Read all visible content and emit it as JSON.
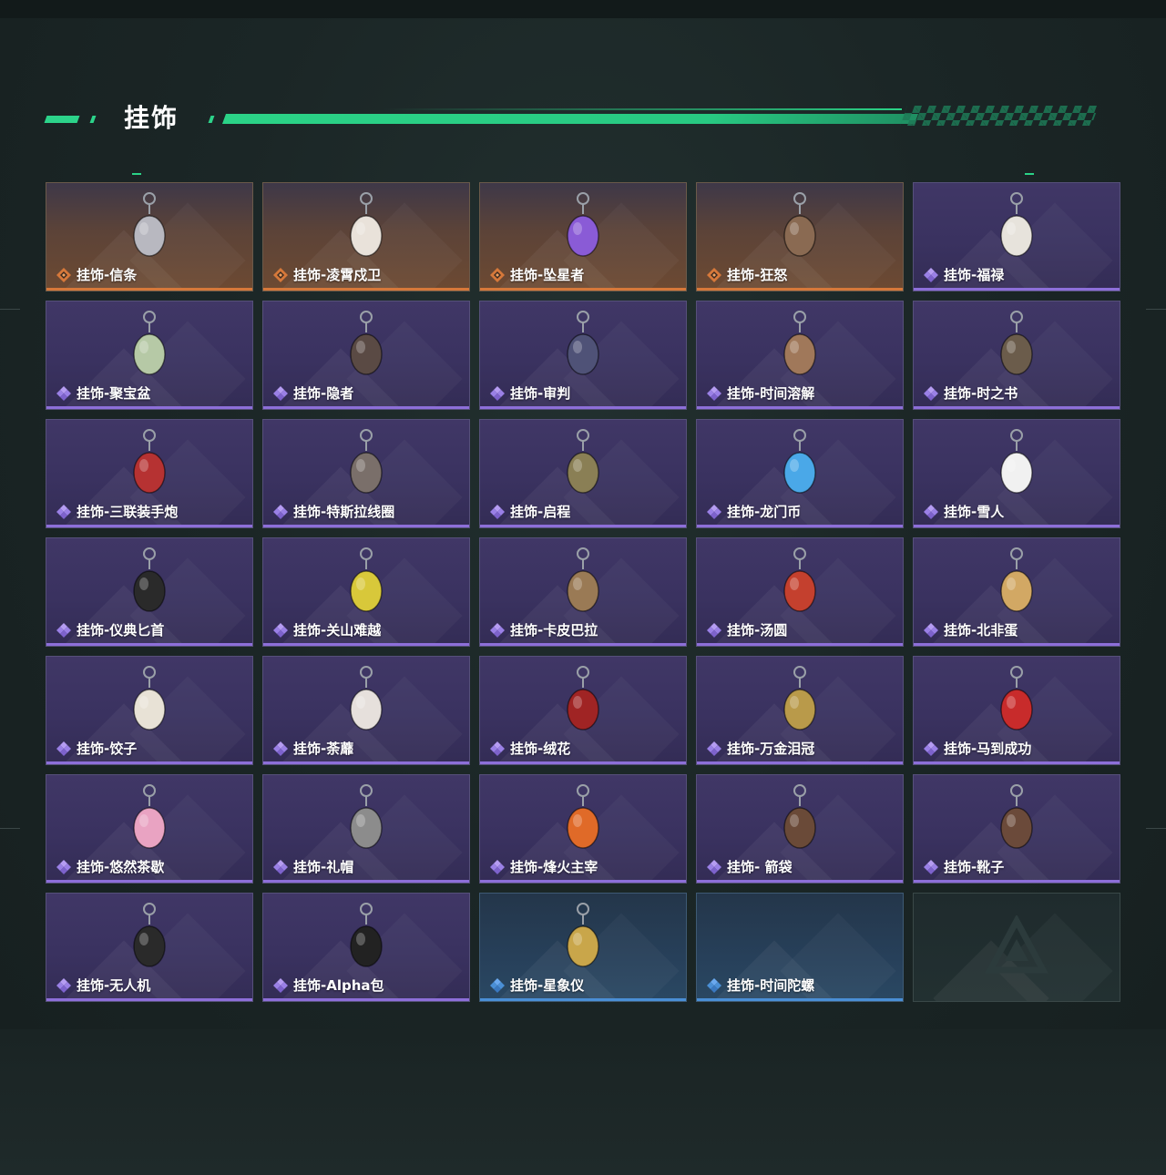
{
  "page": {
    "title": "挂饰"
  },
  "colors": {
    "accent": "#2bd387",
    "purple_rarity": "#8d6fd9",
    "orange_rarity": "#d6783a",
    "blue_rarity": "#4a8fd6"
  },
  "items": [
    {
      "label": "挂饰-信条",
      "rarity": "orange",
      "icon": "charm-silver-pendant",
      "color": "#b8b8c0"
    },
    {
      "label": "挂饰-凌霄戍卫",
      "rarity": "orange",
      "icon": "charm-rocket-figure",
      "color": "#e9e2da"
    },
    {
      "label": "挂饰-坠星者",
      "rarity": "orange",
      "icon": "charm-purple-crystal",
      "color": "#8a5bd6"
    },
    {
      "label": "挂饰-狂怒",
      "rarity": "orange",
      "icon": "charm-bronze-key",
      "color": "#8a6a52"
    },
    {
      "label": "挂饰-福禄",
      "rarity": "purple",
      "icon": "charm-gourd",
      "color": "#e7e3dc"
    },
    {
      "label": "挂饰-聚宝盆",
      "rarity": "purple",
      "icon": "charm-treasure-bowl",
      "color": "#b6c9a6"
    },
    {
      "label": "挂饰-隐者",
      "rarity": "purple",
      "icon": "charm-card-hermit",
      "color": "#5a4a44"
    },
    {
      "label": "挂饰-审判",
      "rarity": "purple",
      "icon": "charm-card-judgement",
      "color": "#4f5277"
    },
    {
      "label": "挂饰-时间溶解",
      "rarity": "purple",
      "icon": "charm-melting-clock",
      "color": "#a0785a"
    },
    {
      "label": "挂饰-时之书",
      "rarity": "purple",
      "icon": "charm-book",
      "color": "#6b5c4b"
    },
    {
      "label": "挂饰-三联装手炮",
      "rarity": "purple",
      "icon": "charm-hand-cannon",
      "color": "#b63232"
    },
    {
      "label": "挂饰-特斯拉线圈",
      "rarity": "purple",
      "icon": "charm-tesla-coil",
      "color": "#7a6f6a"
    },
    {
      "label": "挂饰-启程",
      "rarity": "purple",
      "icon": "charm-compass-medal",
      "color": "#8a7f55"
    },
    {
      "label": "挂饰-龙门币",
      "rarity": "purple",
      "icon": "charm-blue-card",
      "color": "#4aa8e8"
    },
    {
      "label": "挂饰-雪人",
      "rarity": "purple",
      "icon": "charm-snowman",
      "color": "#f1f1f1"
    },
    {
      "label": "挂饰-仪典匕首",
      "rarity": "purple",
      "icon": "charm-dagger",
      "color": "#2a2a2a"
    },
    {
      "label": "挂饰-关山难越",
      "rarity": "purple",
      "icon": "charm-yellow-can",
      "color": "#d8c83a"
    },
    {
      "label": "挂饰-卡皮巴拉",
      "rarity": "purple",
      "icon": "charm-capybara",
      "color": "#9a7a55"
    },
    {
      "label": "挂饰-汤圆",
      "rarity": "purple",
      "icon": "charm-dumpling-bowl",
      "color": "#c4402e"
    },
    {
      "label": "挂饰-北非蛋",
      "rarity": "purple",
      "icon": "charm-shakshuka",
      "color": "#d2a864"
    },
    {
      "label": "挂饰-饺子",
      "rarity": "purple",
      "icon": "charm-dumplings-plate",
      "color": "#e8e2d6"
    },
    {
      "label": "挂饰-荼蘼",
      "rarity": "purple",
      "icon": "charm-white-flower",
      "color": "#e6e0dc"
    },
    {
      "label": "挂饰-绒花",
      "rarity": "purple",
      "icon": "charm-red-rose",
      "color": "#a02424"
    },
    {
      "label": "挂饰-万金泪冠",
      "rarity": "purple",
      "icon": "charm-golden-egg",
      "color": "#b99a4a"
    },
    {
      "label": "挂饰-马到成功",
      "rarity": "purple",
      "icon": "charm-red-horse",
      "color": "#c82b2b"
    },
    {
      "label": "挂饰-悠然茶歇",
      "rarity": "purple",
      "icon": "charm-cupcake",
      "color": "#e9a3c2"
    },
    {
      "label": "挂饰-礼帽",
      "rarity": "purple",
      "icon": "charm-fedora",
      "color": "#8c8c8c"
    },
    {
      "label": "挂饰-烽火主宰",
      "rarity": "purple",
      "icon": "charm-graffiti-container",
      "color": "#e06a28"
    },
    {
      "label": "挂饰- 箭袋",
      "rarity": "purple",
      "icon": "charm-quiver",
      "color": "#6a4a38"
    },
    {
      "label": "挂饰-靴子",
      "rarity": "purple",
      "icon": "charm-boot",
      "color": "#6b4a3a"
    },
    {
      "label": "挂饰-无人机",
      "rarity": "purple",
      "icon": "charm-drone",
      "color": "#2a2a2a"
    },
    {
      "label": "挂饰-Alpha包",
      "rarity": "purple",
      "icon": "charm-black-pouch",
      "color": "#222222"
    },
    {
      "label": "挂饰-星象仪",
      "rarity": "blue",
      "icon": "charm-astrolabe",
      "color": "#c9a64a"
    },
    {
      "label": "挂饰-时间陀螺",
      "rarity": "blue",
      "icon": "",
      "color": ""
    },
    {
      "label": "",
      "rarity": "empty",
      "icon": "placeholder-logo-icon",
      "color": ""
    }
  ]
}
